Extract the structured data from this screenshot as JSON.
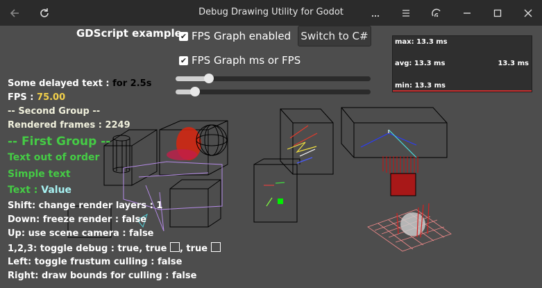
{
  "window": {
    "title": "Debug Drawing Utility for Godot",
    "controls": [
      "back-icon",
      "reload-icon",
      "more-icon",
      "menu-icon",
      "screencast-icon",
      "minimize-icon",
      "maximize-icon",
      "close-icon"
    ]
  },
  "top_ui": {
    "gdscript_label": "GDScript example",
    "fps_graph_checkbox": "FPS Graph enabled",
    "fps_ms_checkbox": "FPS Graph ms or FPS",
    "switch_button": "Switch to C#",
    "slider1_fraction": 0.17,
    "slider2_fraction": 0.1
  },
  "fps_graph": {
    "max": "max: 13.3 ms",
    "avg": "avg: 13.3 ms",
    "current": "13.3 ms",
    "min": "min: 13.3 ms"
  },
  "left_panel": {
    "delayed_label": "Some delayed text :",
    "delayed_value": "for 2.5s",
    "fps_label": "FPS :",
    "fps_value": "75.00",
    "second_group": "-- Second Group --",
    "rendered_frames": "Rendered frames : 2249",
    "first_group": "-- First Group --",
    "text_out_of_order": "Text out of order",
    "simple_text": "Simple text",
    "text_label": "Text :",
    "text_value": "Value",
    "shift": "Shift: change render layers : 1",
    "down": "Down: freeze render : false",
    "up": "Up: use scene camera : false",
    "toggle_debug": "1,2,3: toggle debug : true, true",
    "toggle_debug_tail": ", true",
    "left": "Left: toggle frustum culling : false",
    "right": "Right: draw bounds for culling : false"
  },
  "colors": {
    "titlebar": "#2b2b2b",
    "background": "#4d4d4d",
    "green_text": "#45cc45",
    "yellow_value": "#f2d04a",
    "cyan_value": "#a8f2f2"
  }
}
